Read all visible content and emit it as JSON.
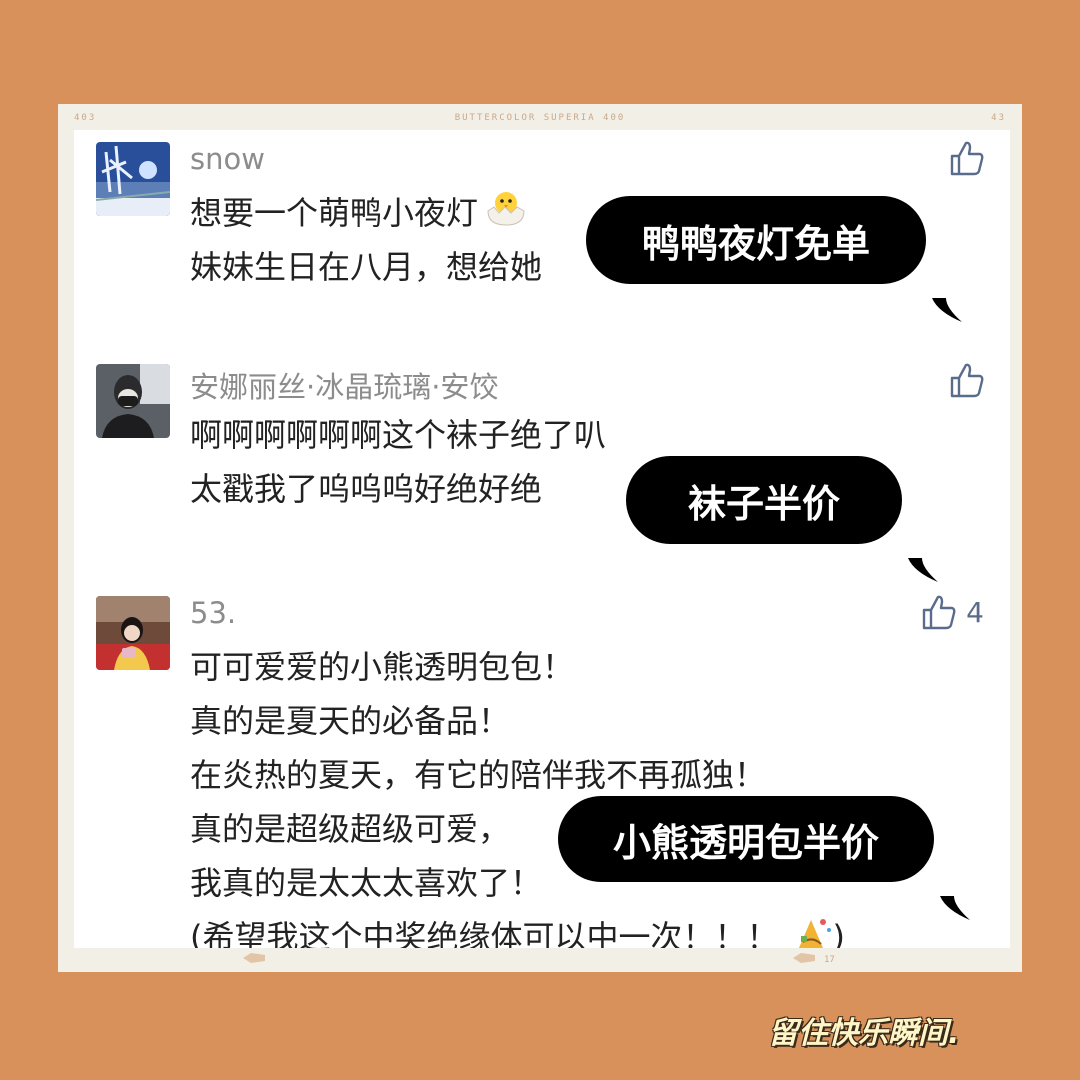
{
  "film": {
    "frame_left": "403",
    "brand": "BUTTERCOLOR SUPERIA 400",
    "frame_right": "43",
    "frame_bottom": "17"
  },
  "comments": [
    {
      "username": "snow",
      "lines": [
        "想要一个萌鸭小夜灯",
        "妹妹生日在八月，想给她"
      ],
      "emoji": "hatching-chick-icon",
      "bubble": "鸭鸭夜灯免单",
      "likes": ""
    },
    {
      "username": "安娜丽丝·冰晶琉璃·安饺",
      "lines": [
        "啊啊啊啊啊啊这个袜子绝了叭",
        "太戳我了呜呜呜好绝好绝"
      ],
      "bubble": "袜子半价",
      "likes": ""
    },
    {
      "username": "53.",
      "lines": [
        "可可爱爱的小熊透明包包！",
        "真的是夏天的必备品！",
        "在炎热的夏天，有它的陪伴我不再孤独！",
        "真的是超级超级可爱，",
        "我真的是太太太喜欢了！",
        "(希望我这个中奖绝缘体可以中一次！！！"
      ],
      "line_end": ")",
      "bubble": "小熊透明包半价",
      "likes": "4"
    }
  ],
  "caption": "留住快乐瞬间.",
  "colors": {
    "background": "#d8915a",
    "bubble": "#000000",
    "like_icon": "#5a6c8c",
    "username": "#8c8c8c"
  }
}
